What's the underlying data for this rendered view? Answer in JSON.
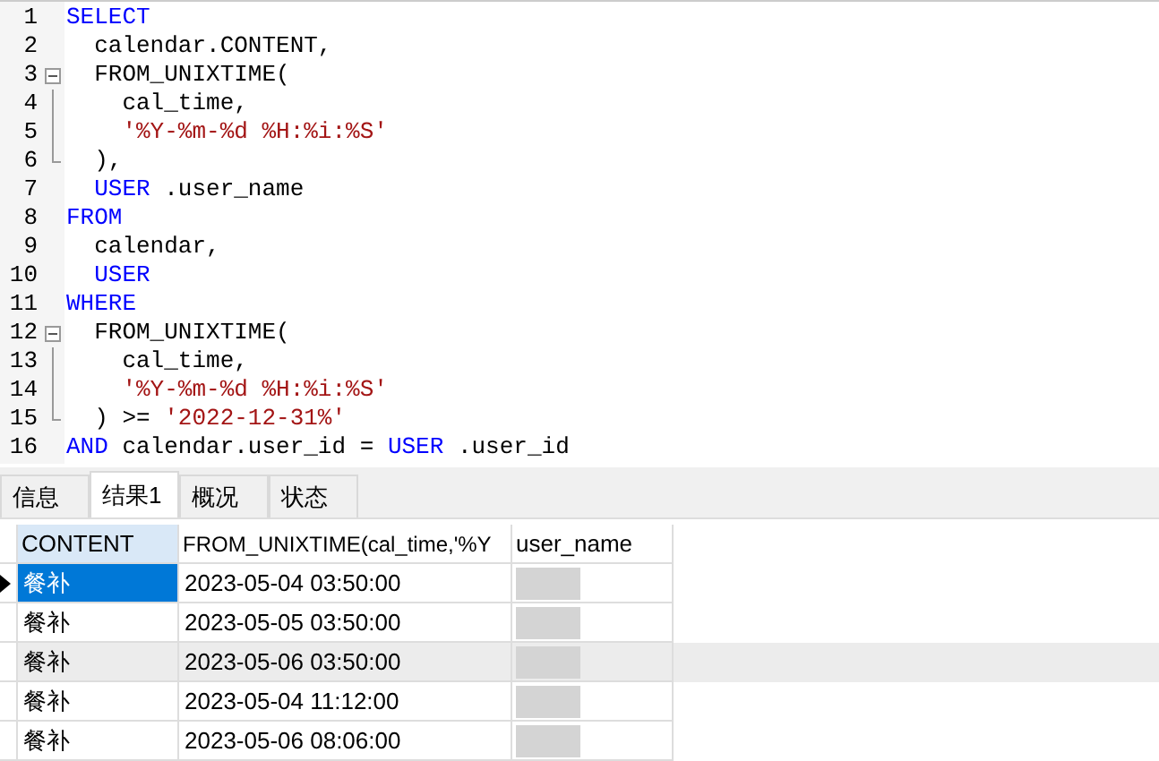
{
  "editor": {
    "lines": [
      {
        "number": "1",
        "kind": "plain",
        "tokens": [
          {
            "text": "SELECT",
            "kind": "keyword"
          }
        ]
      },
      {
        "number": "2",
        "kind": "plain",
        "tokens": [
          {
            "text": "  calendar.CONTENT,",
            "kind": "plain"
          }
        ]
      },
      {
        "number": "3",
        "kind": "fold_start",
        "tokens": [
          {
            "text": "  FROM_UNIXTIME(",
            "kind": "plain"
          }
        ]
      },
      {
        "number": "4",
        "kind": "fold_body",
        "tokens": [
          {
            "text": "    cal_time,",
            "kind": "plain"
          }
        ]
      },
      {
        "number": "5",
        "kind": "fold_body",
        "tokens": [
          {
            "text": "    '%Y-%m-%d %H:%i:%S'",
            "kind": "string"
          }
        ]
      },
      {
        "number": "6",
        "kind": "fold_end",
        "tokens": [
          {
            "text": "  ),",
            "kind": "plain"
          }
        ]
      },
      {
        "number": "7",
        "kind": "plain",
        "tokens": [
          {
            "text": "  USER",
            "kind": "keyword"
          },
          {
            "text": " .user_name",
            "kind": "plain"
          }
        ]
      },
      {
        "number": "8",
        "kind": "plain",
        "tokens": [
          {
            "text": "FROM",
            "kind": "keyword"
          }
        ]
      },
      {
        "number": "9",
        "kind": "plain",
        "tokens": [
          {
            "text": "  calendar,",
            "kind": "plain"
          }
        ]
      },
      {
        "number": "10",
        "kind": "plain",
        "tokens": [
          {
            "text": "  USER",
            "kind": "keyword"
          }
        ]
      },
      {
        "number": "11",
        "kind": "plain",
        "tokens": [
          {
            "text": "WHERE",
            "kind": "keyword"
          }
        ]
      },
      {
        "number": "12",
        "kind": "fold_start",
        "tokens": [
          {
            "text": "  FROM_UNIXTIME(",
            "kind": "plain"
          }
        ]
      },
      {
        "number": "13",
        "kind": "fold_body",
        "tokens": [
          {
            "text": "    cal_time,",
            "kind": "plain"
          }
        ]
      },
      {
        "number": "14",
        "kind": "fold_body",
        "tokens": [
          {
            "text": "    '%Y-%m-%d %H:%i:%S'",
            "kind": "string"
          }
        ]
      },
      {
        "number": "15",
        "kind": "fold_end",
        "tokens": [
          {
            "text": "  ) >= ",
            "kind": "plain"
          },
          {
            "text": "'2022-12-31%'",
            "kind": "string"
          }
        ]
      },
      {
        "number": "16",
        "kind": "plain",
        "tokens": [
          {
            "text": "AND",
            "kind": "keyword"
          },
          {
            "text": " calendar.user_id = ",
            "kind": "plain"
          },
          {
            "text": "USER",
            "kind": "keyword"
          },
          {
            "text": " .user_id",
            "kind": "plain"
          }
        ]
      }
    ]
  },
  "tabs": [
    {
      "label": "信息",
      "selected": false
    },
    {
      "label": "结果1",
      "selected": true
    },
    {
      "label": "概况",
      "selected": false
    },
    {
      "label": "状态",
      "selected": false
    }
  ],
  "table": {
    "columns": [
      "CONTENT",
      "FROM_UNIXTIME(cal_time,'%Y",
      "user_name"
    ],
    "rows": [
      {
        "selected": true,
        "cells": [
          "餐补",
          "2023-05-04 03:50:00"
        ]
      },
      {
        "selected": false,
        "cells": [
          "餐补",
          "2023-05-05 03:50:00"
        ]
      },
      {
        "selected": false,
        "cells": [
          "餐补",
          "2023-05-06 03:50:00"
        ]
      },
      {
        "selected": false,
        "cells": [
          "餐补",
          "2023-05-04 11:12:00"
        ]
      },
      {
        "selected": false,
        "cells": [
          "餐补",
          "2023-05-06 08:06:00"
        ]
      }
    ]
  }
}
